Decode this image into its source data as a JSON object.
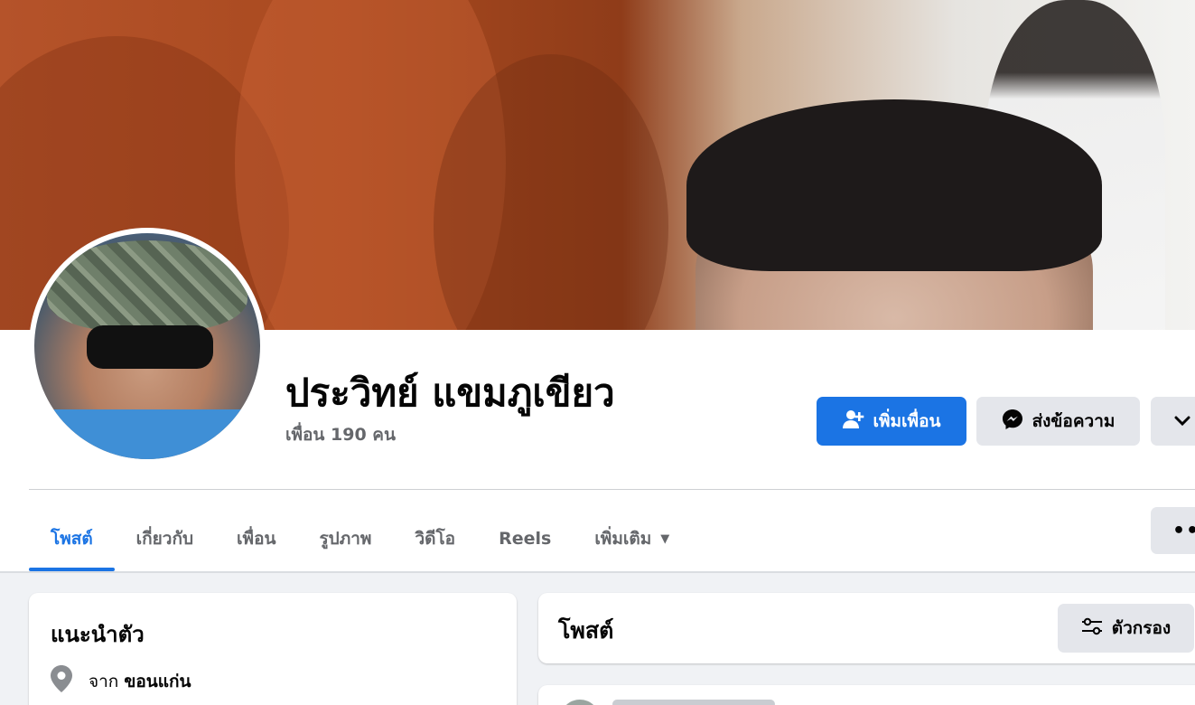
{
  "profile": {
    "name": "ประวิทย์ แขมภูเขียว",
    "friends_count": "เพื่อน 190 คน"
  },
  "actions": {
    "add_friend": "เพิ่มเพื่อน",
    "message": "ส่งข้อความ"
  },
  "tabs": [
    {
      "label": "โพสต์",
      "active": true
    },
    {
      "label": "เกี่ยวกับ",
      "active": false
    },
    {
      "label": "เพื่อน",
      "active": false
    },
    {
      "label": "รูปภาพ",
      "active": false
    },
    {
      "label": "วิดีโอ",
      "active": false
    },
    {
      "label": "Reels",
      "active": false
    },
    {
      "label": "เพิ่มเติม",
      "active": false
    }
  ],
  "intro": {
    "title": "แนะนำตัว",
    "from_prefix": "จาก",
    "from_place": "ขอนแก่น"
  },
  "posts": {
    "title": "โพสต์",
    "filter_label": "ตัวกรอง"
  },
  "colors": {
    "accent": "#1b74e4",
    "secondary_button": "#e4e6eb",
    "page_background": "#f0f2f5"
  }
}
